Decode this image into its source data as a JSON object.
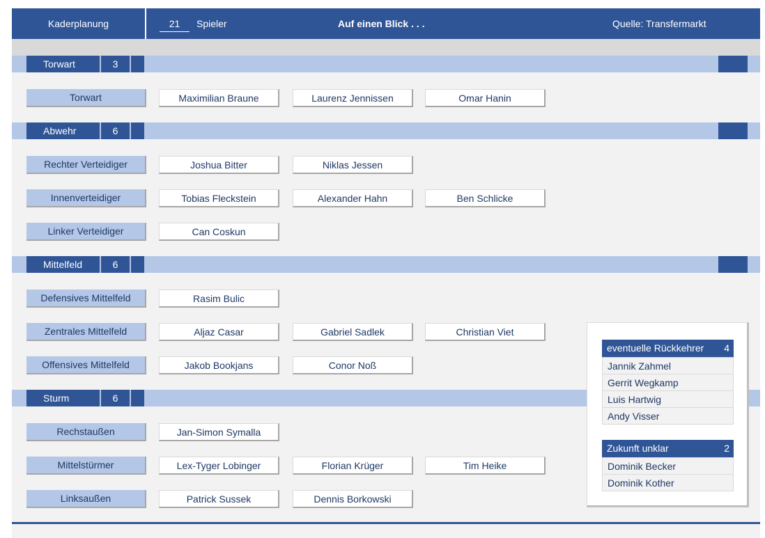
{
  "header": {
    "title": "Kaderplanung",
    "player_count": "21",
    "player_label": "Spieler",
    "glance": "Auf einen Blick . . .",
    "source": "Quelle: Transfermarkt"
  },
  "sections": [
    {
      "name": "Torwart",
      "count": "3",
      "rows": [
        {
          "position": "Torwart",
          "players": [
            "Maximilian Braune",
            "Laurenz Jennissen",
            "Omar Hanin"
          ]
        }
      ]
    },
    {
      "name": "Abwehr",
      "count": "6",
      "rows": [
        {
          "position": "Rechter Verteidiger",
          "players": [
            "Joshua Bitter",
            "Niklas Jessen"
          ]
        },
        {
          "position": "Innenverteidiger",
          "players": [
            "Tobias Fleckstein",
            "Alexander Hahn",
            "Ben Schlicke"
          ]
        },
        {
          "position": "Linker Verteidiger",
          "players": [
            "Can Coskun"
          ]
        }
      ]
    },
    {
      "name": "Mittelfeld",
      "count": "6",
      "rows": [
        {
          "position": "Defensives Mittelfeld",
          "players": [
            "Rasim Bulic"
          ]
        },
        {
          "position": "Zentrales Mittelfeld",
          "players": [
            "Aljaz Casar",
            "Gabriel Sadlek",
            "Christian Viet"
          ]
        },
        {
          "position": "Offensives Mittelfeld",
          "players": [
            "Jakob Bookjans",
            "Conor Noß"
          ]
        }
      ]
    },
    {
      "name": "Sturm",
      "count": "6",
      "rows": [
        {
          "position": "Rechstaußen",
          "players": [
            "Jan-Simon Symalla"
          ]
        },
        {
          "position": "Mittelstürmer",
          "players": [
            "Lex-Tyger Lobinger",
            "Florian Krüger",
            "Tim Heike"
          ]
        },
        {
          "position": "Linksaußen",
          "players": [
            "Patrick Sussek",
            "Dennis Borkowski"
          ]
        }
      ]
    }
  ],
  "side_panel": {
    "returnees": {
      "title": "eventuelle Rückkehrer",
      "count": "4",
      "items": [
        "Jannik Zahmel",
        "Gerrit Wegkamp",
        "Luis Hartwig",
        "Andy Visser"
      ]
    },
    "unclear": {
      "title": "Zukunft unklar",
      "count": "2",
      "items": [
        "Dominik Becker",
        "Dominik Kother"
      ]
    }
  },
  "colors": {
    "primary": "#2f5597",
    "light": "#b4c7e7",
    "background": "#f2f2f2",
    "text": "#1f3864"
  }
}
